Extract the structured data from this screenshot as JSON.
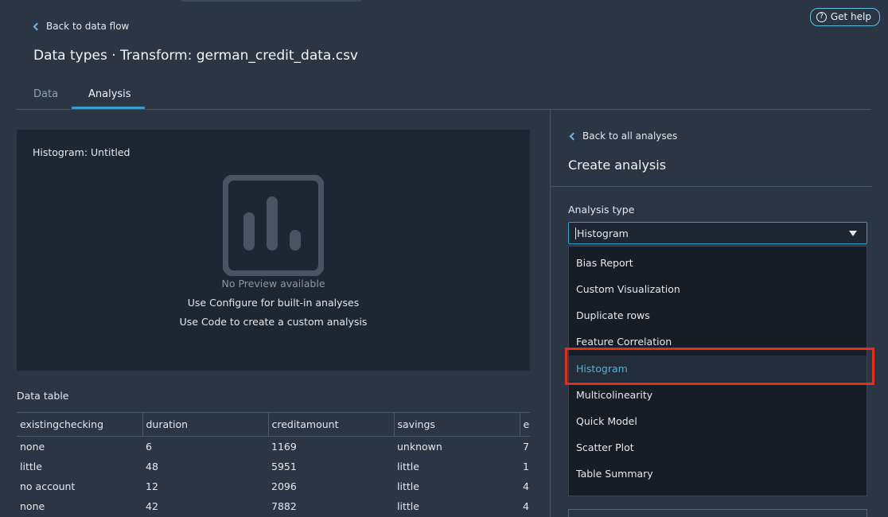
{
  "header": {
    "back_label": "Back to data flow",
    "title": "Data types · Transform: german_credit_data.csv",
    "help_label": "Get help",
    "help_icon": "question-circle-icon"
  },
  "tabs": [
    {
      "label": "Data",
      "active": false
    },
    {
      "label": "Analysis",
      "active": true
    }
  ],
  "preview": {
    "title": "Histogram: Untitled",
    "icon": "bar-chart-icon",
    "line1": "No Preview available",
    "line2": "Use Configure for built-in analyses",
    "line3": "Use Code to create a custom analysis"
  },
  "data_table": {
    "title": "Data table",
    "columns": [
      "existingchecking",
      "duration",
      "creditamount",
      "savings",
      "e"
    ],
    "rows": [
      [
        "none",
        "6",
        "1169",
        "unknown",
        "7"
      ],
      [
        "little",
        "48",
        "5951",
        "little",
        "1"
      ],
      [
        "no account",
        "12",
        "2096",
        "little",
        "4"
      ],
      [
        "none",
        "42",
        "7882",
        "little",
        "4"
      ]
    ]
  },
  "right_panel": {
    "back_label": "Back to all analyses",
    "title": "Create analysis",
    "analysis_type_label": "Analysis type",
    "selected_value": "Histogram",
    "options": [
      "Bias Report",
      "Custom Visualization",
      "Duplicate rows",
      "Feature Correlation",
      "Histogram",
      "Multicolinearity",
      "Quick Model",
      "Scatter Plot",
      "Table Summary"
    ],
    "selected_index": 4
  },
  "colors": {
    "background": "#2b3544",
    "panel": "#1e2631",
    "accent": "#3d9bc8",
    "selected_text": "#4bb3e0",
    "highlight": "#e0301e"
  }
}
